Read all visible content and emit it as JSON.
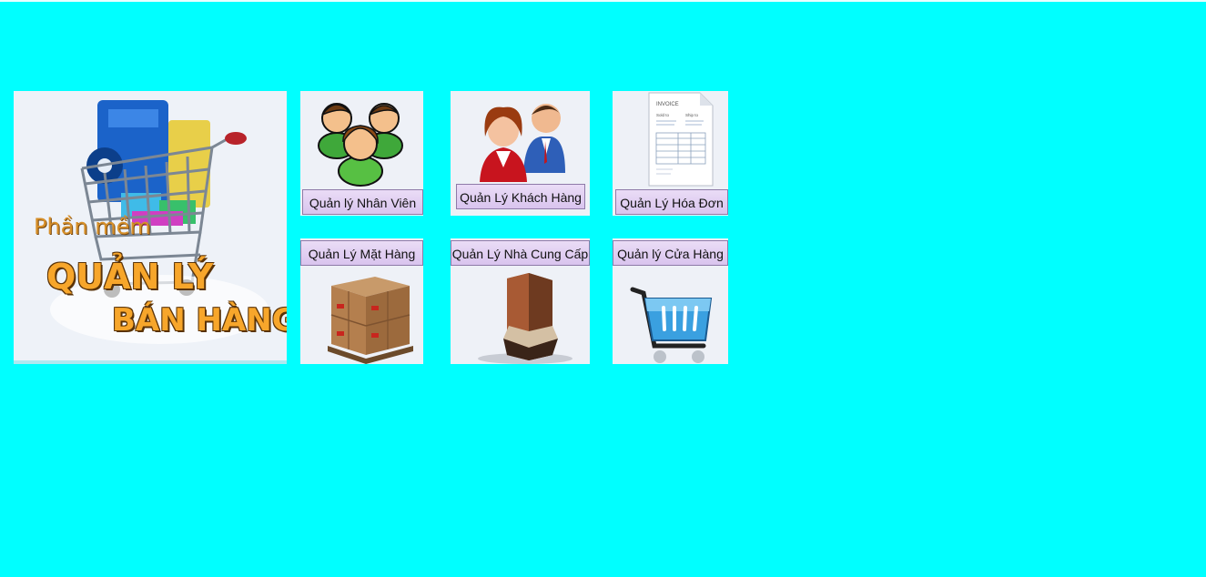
{
  "app": {
    "background_color": "#00ffff"
  },
  "logo": {
    "icon": "shopping-cart-logo-icon",
    "line1": "Phần mềm",
    "line2": "QUẢN LÝ",
    "line3": "BÁN HÀNG"
  },
  "tiles": {
    "nhan_vien": {
      "label": "Quản lý Nhân Viên",
      "icon": "employees-icon"
    },
    "khach_hang": {
      "label": "Quản Lý Khách Hàng",
      "icon": "customers-icon"
    },
    "hoa_don": {
      "label": "Quản Lý Hóa Đơn",
      "icon": "invoice-icon"
    },
    "mat_hang": {
      "label": "Quản Lý Mặt Hàng",
      "icon": "boxes-icon"
    },
    "nha_cung_cap": {
      "label": "Quản Lý Nhà Cung Cấp",
      "icon": "warehouse-icon"
    },
    "cua_hang": {
      "label": "Quản lý Cửa Hàng",
      "icon": "shopping-basket-icon"
    }
  },
  "invoice_doc": {
    "heading": "INVOICE",
    "sold_to": "Sold to",
    "ship_to": "Ship to"
  }
}
